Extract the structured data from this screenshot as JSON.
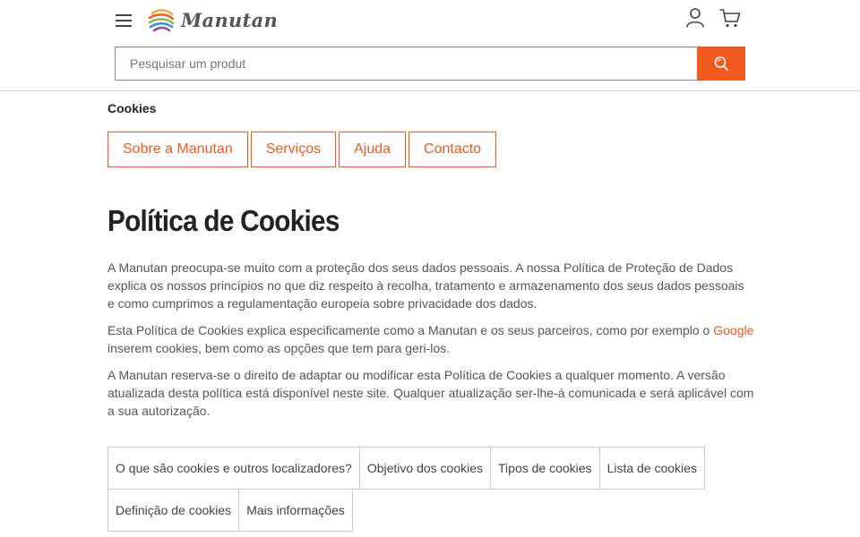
{
  "header": {
    "logo_text": "Manutan",
    "search_placeholder": "Pesquisar um produt"
  },
  "breadcrumb": "Cookies",
  "nav_tabs": [
    "Sobre a Manutan",
    "Serviços",
    "Ajuda",
    "Contacto"
  ],
  "page_title": "Política de Cookies",
  "intro": {
    "p1": "A Manutan preocupa-se muito com a proteção dos seus dados pessoais. A nossa Política de Proteção de Dados explica os nossos princípios no que diz respeito à recolha, tratamento e armazenamento dos seus dados pessoais e como cumprimos a regulamentação europeia sobre privacidade dos dados.",
    "p2_before": "Esta Política de Cookies explica especificamente como a Manutan e os seus parceiros, como por exemplo o ",
    "p2_link": "Google",
    "p2_after": " inserem cookies, bem como as opções que tem para geri-los.",
    "p3": "A Manutan reserva-se o direito de adaptar ou modificar esta Política de Cookies a qualquer momento. A versão atualizada desta política está disponível neste site. Qualquer atualização ser-lhe-á comunicada e será aplicável com a sua autorização."
  },
  "toc": {
    "row1": [
      "O que são cookies e outros localizadores?",
      "Objetivo dos cookies",
      "Tipos de cookies",
      "Lista de cookies"
    ],
    "row2": [
      "Definição de cookies",
      "Mais informações"
    ]
  },
  "colors": {
    "accent": "#f05a1e",
    "text": "#555555",
    "border": "#cccccc"
  },
  "icons": {
    "menu": "hamburger-menu-icon",
    "user": "user-icon",
    "cart": "cart-icon",
    "search": "search-icon"
  }
}
